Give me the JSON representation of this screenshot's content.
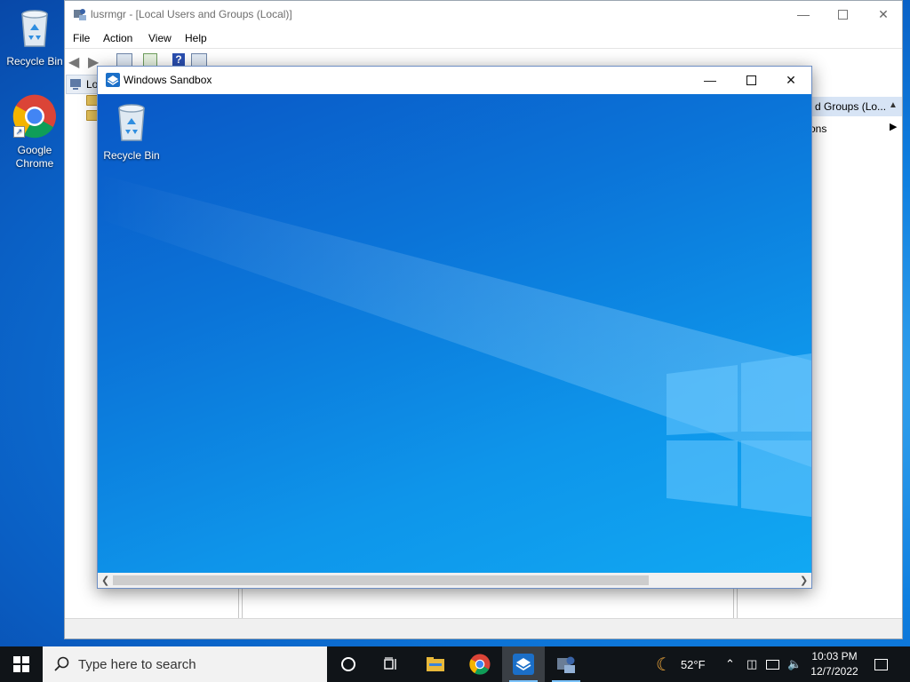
{
  "desktop": {
    "icons": [
      {
        "label": "Recycle Bin"
      },
      {
        "label": "Google Chrome"
      }
    ]
  },
  "lusrmgr": {
    "title": "lusrmgr - [Local Users and Groups (Local)]",
    "menu": [
      "File",
      "Action",
      "View",
      "Help"
    ],
    "tree_root": "Lo",
    "actions_header": "d Groups (Lo...",
    "more_actions": "ons"
  },
  "sandbox": {
    "title": "Windows Sandbox",
    "desktop_icon_label": "Recycle Bin"
  },
  "taskbar": {
    "search_placeholder": "Type here to search",
    "weather": "52°F",
    "time": "10:03 PM",
    "date": "12/7/2022"
  }
}
